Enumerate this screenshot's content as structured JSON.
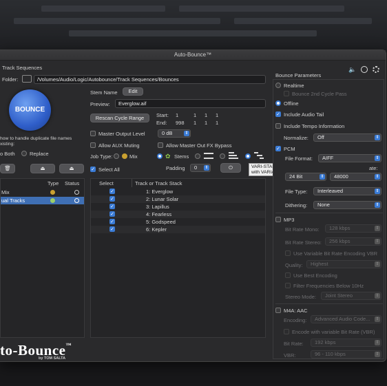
{
  "window": {
    "title": "Auto-Bounce™"
  },
  "left": {
    "section_title": "Track Sequences",
    "folder_label": "Folder:",
    "folder_path": "/Volumes/Audio/Logic/Autobounce/Track Sequences/Bounces",
    "bounce_button": "BOUNCE",
    "dup_text_1": "how to handle duplicate file names",
    "dup_text_2": "xisting:",
    "dup_opt_both": "o Both",
    "dup_opt_replace": "Replace",
    "table_headers": {
      "type": "Type",
      "status": "Status"
    },
    "rows": [
      {
        "name": "Mix",
        "selected": false
      },
      {
        "name": "ual Tracks",
        "selected": true
      }
    ],
    "logo_main": "to-Bounce",
    "logo_tm": "™",
    "logo_sub": "by TOM SALTA"
  },
  "middle": {
    "stem_name_label": "Stem Name",
    "edit_button": "Edit",
    "preview_label": "Preview:",
    "preview_value": "Everglow.aif",
    "rescan_button": "Rescan Cycle Range",
    "start_label": "Start:",
    "end_label": "End:",
    "start_values": [
      "1",
      "1",
      "1",
      "1"
    ],
    "end_values": [
      "998",
      "1",
      "1",
      "1"
    ],
    "master_output_level_label": "Master Output Level",
    "master_output_level_value": "0 dB",
    "allow_aux_muting": "Allow AUX Muting",
    "allow_master_fx_bypass": "Allow Master Out FX Bypass",
    "job_type_label": "Job Type:",
    "job_mix": "Mix",
    "job_stems": "Stems",
    "select_all": "Select All",
    "padding_label": "Padding",
    "padding_value": "0",
    "tooltip_line1": "VARI-START&END: Bounce each selected item",
    "tooltip_line2": "with VARIABLE START & END set by Regions",
    "list_headers": {
      "select": "Select",
      "track": "Track or Track Stack"
    },
    "tracks": [
      "1:  Everglow",
      "2:  Lunar Solar",
      "3:  Lapillus",
      "4:  Fearless",
      "5:  Godspeed",
      "6:  Kepler"
    ]
  },
  "right": {
    "title": "Bounce Parameters",
    "realtime": "Realtime",
    "bounce_2nd_cycle": "Bounce 2nd Cycle Pass",
    "offline": "Offline",
    "include_audio_tail": "Include Audio Tail",
    "include_tempo": "Include Tempo Information",
    "normalize_label": "Normalize:",
    "normalize_value": "Off",
    "pcm": "PCM",
    "file_format_label": "File Format:",
    "file_format_value": "AIFF",
    "bit_depth_value": "24 Bit",
    "sample_rate_label_partial": "ate:",
    "sample_rate_value": "48000",
    "file_type_label": "File Type:",
    "file_type_value": "Interleaved",
    "dithering_label": "Dithering:",
    "dithering_value": "None",
    "mp3": "MP3",
    "mp3_bitrate_mono_label": "Bit Rate Mono:",
    "mp3_bitrate_mono_value": "128 kbps",
    "mp3_bitrate_stereo_label": "Bit Rate Stereo:",
    "mp3_bitrate_stereo_value": "256 kbps",
    "mp3_vbr": "Use Variable Bit Rate Encoding VBR",
    "mp3_quality_label": "Quality:",
    "mp3_quality_value": "Highest",
    "mp3_best_encoding": "Use Best Encoding",
    "mp3_filter": "Filter Frequencies Below 10Hz",
    "mp3_stereo_mode_label": "Stereo Mode:",
    "mp3_stereo_mode_value": "Joint Stereo",
    "m4a": "M4A: AAC",
    "m4a_encoding_label": "Encoding:",
    "m4a_encoding_value": "Advanced Audio Code...",
    "m4a_vbr": "Encode with variable Bit Rate (VBR)",
    "m4a_bitrate_label": "Bit Rate:",
    "m4a_bitrate_value": "192 kbps",
    "m4a_vbr_label": "VBR:",
    "m4a_vbr_value": "96 - 110 kbps"
  },
  "colors": {
    "accent": "#3a7bd5",
    "window_bg": "#2a2a2c",
    "selected_row": "#3f6fb4"
  }
}
